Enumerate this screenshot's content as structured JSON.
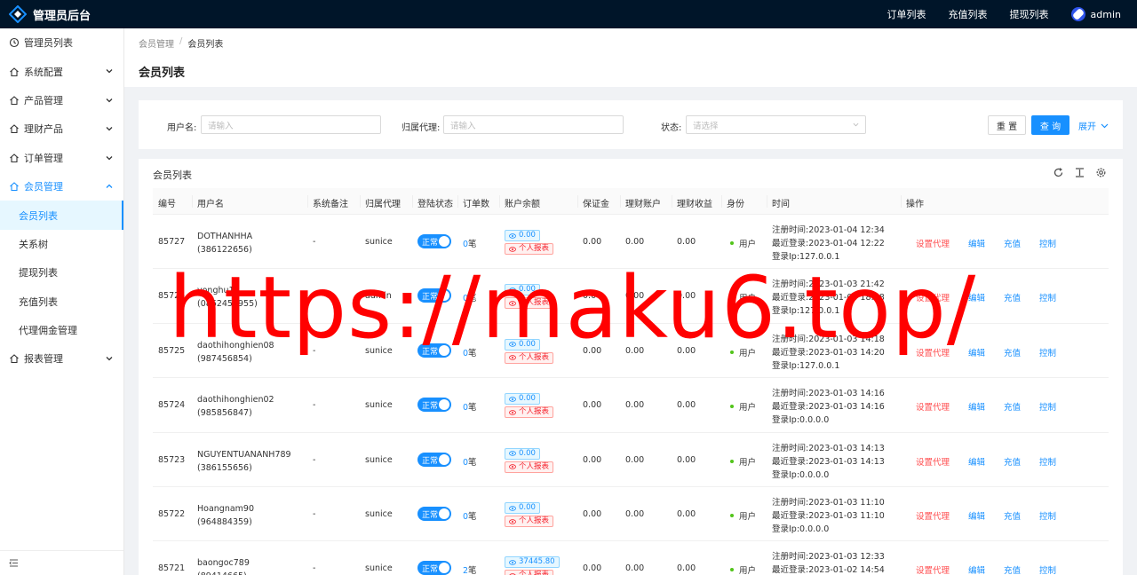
{
  "app": {
    "title": "管理员后台",
    "user": "admin"
  },
  "topnav": [
    "订单列表",
    "充值列表",
    "提现列表"
  ],
  "sidebar": {
    "items": [
      {
        "label": "管理员列表",
        "icon": "clock-icon",
        "chevron": false
      },
      {
        "label": "系统配置",
        "icon": "home-icon",
        "chevron": true
      },
      {
        "label": "产品管理",
        "icon": "home-icon",
        "chevron": true
      },
      {
        "label": "理财产品",
        "icon": "home-icon",
        "chevron": true
      },
      {
        "label": "订单管理",
        "icon": "home-icon",
        "chevron": true
      },
      {
        "label": "会员管理",
        "icon": "home-icon",
        "chevron": true,
        "expanded": true
      },
      {
        "label": "会员列表",
        "sub": true,
        "active": true
      },
      {
        "label": "关系树",
        "sub": true
      },
      {
        "label": "提现列表",
        "sub": true
      },
      {
        "label": "充值列表",
        "sub": true
      },
      {
        "label": "代理佣金管理",
        "sub": true
      },
      {
        "label": "报表管理",
        "icon": "home-icon",
        "chevron": true
      }
    ]
  },
  "breadcrumb": [
    "会员管理",
    "会员列表"
  ],
  "breadcrumb_sep": "/",
  "page_title": "会员列表",
  "filters": {
    "username_label": "用户名:",
    "username_placeholder": "请输入",
    "agent_label": "归属代理:",
    "agent_placeholder": "请输入",
    "status_label": "状态:",
    "status_placeholder": "请选择",
    "reset": "重 置",
    "query": "查 询",
    "expand": "展开"
  },
  "table": {
    "title": "会员列表",
    "columns": [
      "编号",
      "用户名",
      "系统备注",
      "归属代理",
      "登陆状态",
      "订单数",
      "账户余额",
      "保证金",
      "理财账户",
      "理财收益",
      "身份",
      "时间",
      "操作"
    ],
    "toggle_label": "正常",
    "order_suffix": "笔",
    "report_label": "个人报表",
    "role_label": "用户",
    "actions": [
      "设置代理",
      "编辑",
      "充值",
      "控制"
    ],
    "rows": [
      {
        "id": "85727",
        "username": "DOTHANHHA",
        "phone": "(386122656)",
        "remark": "-",
        "agent": "sunice",
        "orders": "0",
        "balance": "0.00",
        "deposit": "0.00",
        "wealth": "0.00",
        "earnings": "0.00",
        "reg": "注册时间:2023-01-04 12:34",
        "login": "最近登录:2023-01-04 12:22",
        "ip": "登录Ip:127.0.0.1"
      },
      {
        "id": "85726",
        "username": "yonghu11",
        "phone": "(0862450955)",
        "remark": "-",
        "agent": "admin",
        "orders": "0",
        "balance": "0.00",
        "deposit": "0.00",
        "wealth": "0.00",
        "earnings": "0.00",
        "reg": "注册时间:2023-01-03 21:42",
        "login": "最近登录:2023-01-03 18:48",
        "ip": "登录Ip:127.0.0.1"
      },
      {
        "id": "85725",
        "username": "daothihonghien08",
        "phone": "(987456854)",
        "remark": "-",
        "agent": "sunice",
        "orders": "0",
        "balance": "0.00",
        "deposit": "0.00",
        "wealth": "0.00",
        "earnings": "0.00",
        "reg": "注册时间:2023-01-03 14:18",
        "login": "最近登录:2023-01-03 14:20",
        "ip": "登录Ip:127.0.0.1"
      },
      {
        "id": "85724",
        "username": "daothihonghien02",
        "phone": "(985856847)",
        "remark": "-",
        "agent": "sunice",
        "orders": "0",
        "balance": "0.00",
        "deposit": "0.00",
        "wealth": "0.00",
        "earnings": "0.00",
        "reg": "注册时间:2023-01-03 14:16",
        "login": "最近登录:2023-01-03 14:16",
        "ip": "登录Ip:0.0.0.0"
      },
      {
        "id": "85723",
        "username": "NGUYENTUANANH789",
        "phone": "(386155656)",
        "remark": "-",
        "agent": "sunice",
        "orders": "0",
        "balance": "0.00",
        "deposit": "0.00",
        "wealth": "0.00",
        "earnings": "0.00",
        "reg": "注册时间:2023-01-03 14:13",
        "login": "最近登录:2023-01-03 14:13",
        "ip": "登录Ip:0.0.0.0"
      },
      {
        "id": "85722",
        "username": "Hoangnam90",
        "phone": "(964884359)",
        "remark": "-",
        "agent": "sunice",
        "orders": "0",
        "balance": "0.00",
        "deposit": "0.00",
        "wealth": "0.00",
        "earnings": "0.00",
        "reg": "注册时间:2023-01-03 11:10",
        "login": "最近登录:2023-01-03 11:10",
        "ip": "登录Ip:0.0.0.0"
      },
      {
        "id": "85721",
        "username": "baongoc789",
        "phone": "(89414665)",
        "remark": "-",
        "agent": "sunice",
        "orders": "2",
        "balance": "37445.80",
        "deposit": "0.00",
        "wealth": "0.00",
        "earnings": "0.00",
        "reg": "注册时间:2023-01-03 12:33",
        "login": "最近登录:2023-01-02 14:54",
        "ip": "登录Ip:127.0.0.1"
      }
    ]
  },
  "watermark": "https://maku6.top/",
  "colors": {
    "topbar": "#001529",
    "primary": "#1890ff",
    "danger": "#ff4d4f",
    "success": "#52c41a",
    "watermark": "#ff0000"
  }
}
